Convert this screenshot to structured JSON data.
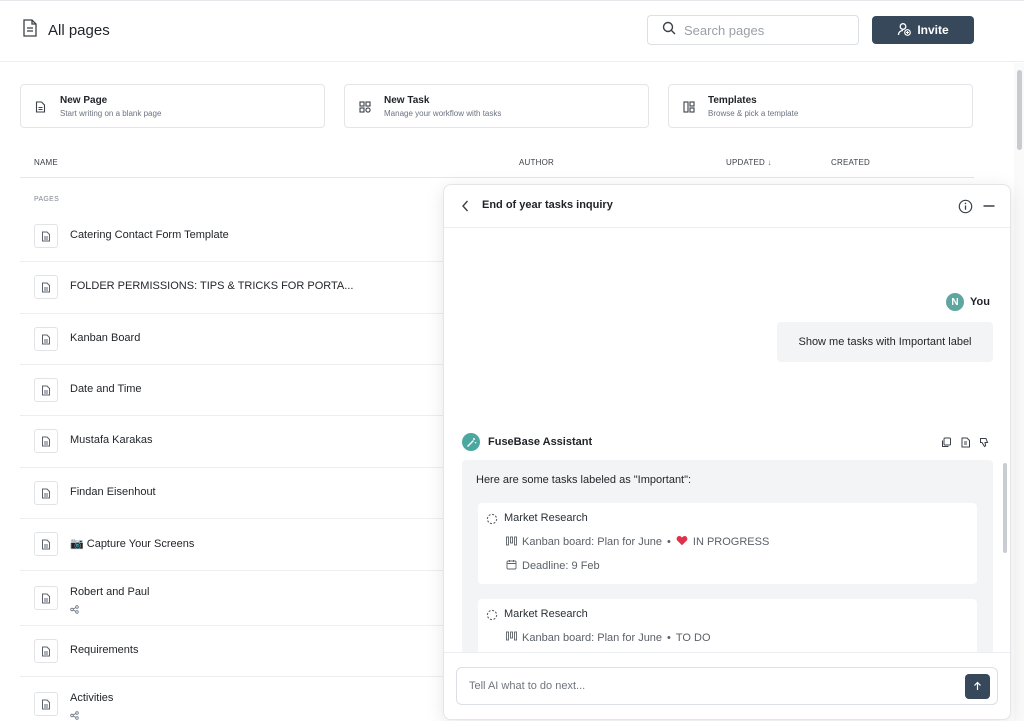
{
  "header": {
    "title": "All pages",
    "title_icon": "document-icon",
    "search_placeholder": "Search pages",
    "invite_label": "Invite"
  },
  "quick_actions": [
    {
      "title": "New Page",
      "subtitle": "Start writing on a blank page",
      "icon": "new-page-icon"
    },
    {
      "title": "New Task",
      "subtitle": "Manage your workflow with tasks",
      "icon": "task-grid-icon"
    },
    {
      "title": "Templates",
      "subtitle": "Browse & pick a template",
      "icon": "templates-icon"
    }
  ],
  "table": {
    "columns": {
      "name": "NAME",
      "author": "AUTHOR",
      "updated": "UPDATED",
      "created": "CREATED"
    },
    "sort_indicator": "↓",
    "section_label": "PAGES",
    "rows": [
      {
        "name": "Catering Contact Form Template"
      },
      {
        "name": "FOLDER PERMISSIONS: TIPS & TRICKS FOR PORTA..."
      },
      {
        "name": "Kanban Board"
      },
      {
        "name": "Date and Time"
      },
      {
        "name": "Mustafa Karakas"
      },
      {
        "name": "Findan Eisenhout"
      },
      {
        "name": "📷 Capture Your Screens"
      },
      {
        "name": "Robert and Paul",
        "shared": true
      },
      {
        "name": "Requirements"
      },
      {
        "name": "Activities",
        "shared": true
      }
    ]
  },
  "chat": {
    "title": "End of year tasks inquiry",
    "user": {
      "avatar_letter": "N",
      "name": "You",
      "message": "Show me tasks with Important label"
    },
    "assistant": {
      "name": "FuseBase Assistant",
      "intro": "Here are some tasks labeled as \"Important\":",
      "tasks": [
        {
          "name": "Market Research",
          "board": "Kanban board: Plan for June",
          "status": "IN PROGRESS",
          "status_emoji": "❤️",
          "deadline": "Deadline: 9 Feb"
        },
        {
          "name": "Market Research",
          "board": "Kanban board: Plan for June",
          "status": "TO DO"
        }
      ]
    },
    "input_placeholder": "Tell AI what to do next..."
  },
  "colors": {
    "accent": "#36485a",
    "assistant_green": "#4ca7a1"
  }
}
